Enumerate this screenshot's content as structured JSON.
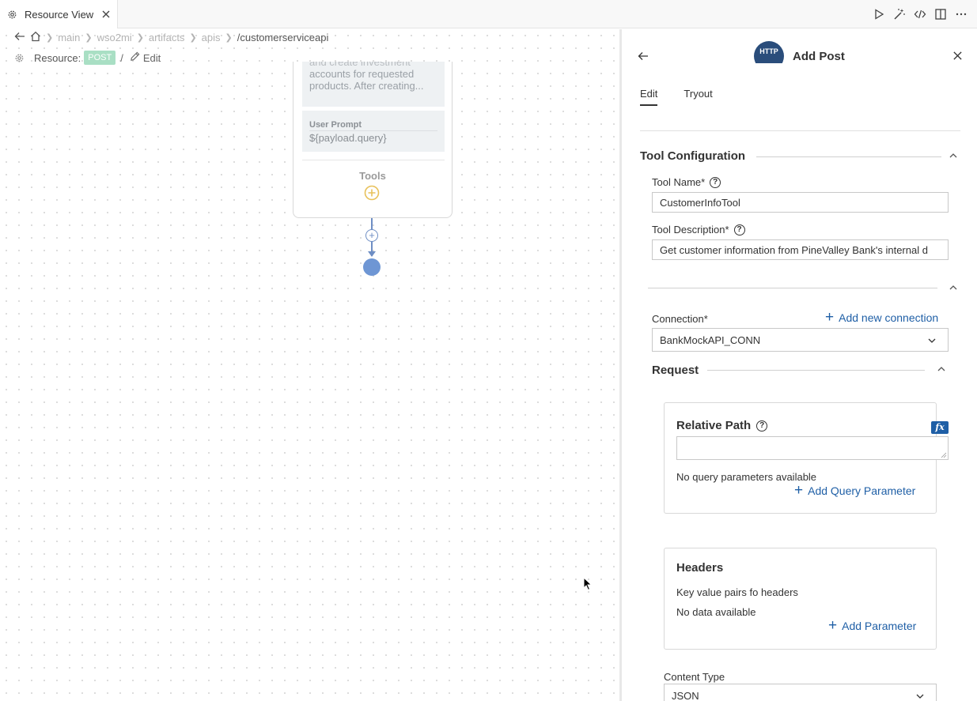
{
  "tab": {
    "title": "Resource View"
  },
  "breadcrumb": {
    "items": [
      "main",
      "wso2mi",
      "artifacts",
      "apis"
    ],
    "last": "/customerserviceapi"
  },
  "resource": {
    "label": "Resource:",
    "method": "POST",
    "separator": "/",
    "edit_label": "Edit"
  },
  "node": {
    "description_lines": [
      "and create investment",
      "accounts for requested",
      "products. After creating..."
    ],
    "prompt_label": "User Prompt",
    "prompt_value": "${payload.query}",
    "tools_label": "Tools"
  },
  "panel": {
    "icon_text": "HTTP",
    "title": "Add Post",
    "tabs": {
      "edit": "Edit",
      "tryout": "Tryout"
    },
    "tool_config": {
      "title": "Tool Configuration",
      "name_label": "Tool Name*",
      "name_value": "CustomerInfoTool",
      "desc_label": "Tool Description*",
      "desc_value": "Get customer information from PineValley Bank's internal d"
    },
    "connection": {
      "label": "Connection*",
      "add_label": "Add new connection",
      "value": "BankMockAPI_CONN"
    },
    "request": {
      "title": "Request",
      "relative_path_title": "Relative Path",
      "fx_label": "fx",
      "no_query": "No query parameters available",
      "add_query": "Add Query Parameter",
      "headers_title": "Headers",
      "headers_desc": "Key value pairs fo headers",
      "headers_empty": "No data available",
      "add_param": "Add Parameter",
      "content_type_label": "Content Type",
      "content_type_value": "JSON"
    }
  }
}
